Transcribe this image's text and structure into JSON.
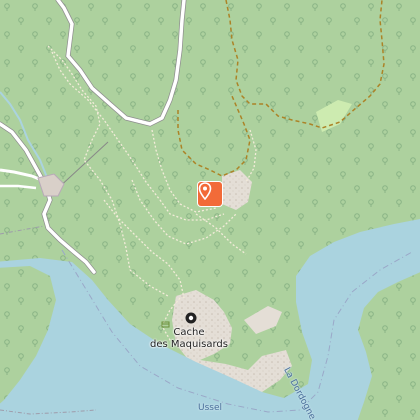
{
  "map": {
    "labels": {
      "cache_name_line1": "Cache",
      "cache_name_line2": "des Maquisards",
      "river_name": "La Dordogne",
      "place_name": "Ussel"
    },
    "selected_marker": {
      "icon": "map-pin-icon",
      "color": "#f26b38"
    },
    "poi": {
      "icon": "monument-icon"
    },
    "colors": {
      "forest": "#add19e",
      "water": "#aad3df",
      "rock": "#e4ded6",
      "meadow": "#cdebb0",
      "road": "#ffffff",
      "track": "#ac8327",
      "boundary": "#9e9cab"
    }
  }
}
